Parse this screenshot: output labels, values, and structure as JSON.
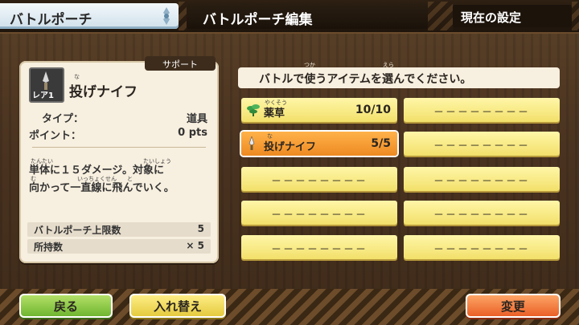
{
  "header": {
    "pouch_tab": "バトルポーチ",
    "screen_title": "バトルポーチ編集",
    "current_setting_button": "現在の設定"
  },
  "item_detail": {
    "category_tag": "サポート",
    "rarity": "レア1",
    "name": "投げナイフ",
    "name_furigana": "な",
    "type_label": "タイプ：",
    "type_value": "道具",
    "points_label": "ポイント：",
    "points_value": "0 pts",
    "description_line1": "単体に１５ダメージ。対象に",
    "description_line2": "向かって一直線に飛んでいく。",
    "furigana_tantai": "たんたい",
    "furigana_taishou": "たいしょう",
    "furigana_mu": "む",
    "furigana_icchokusen": "いっちょくせん",
    "furigana_to": "と",
    "pouch_limit_label": "バトルポーチ上限数",
    "pouch_limit_value": "5",
    "owned_label": "所持数",
    "owned_value": "× 5"
  },
  "prompt": {
    "text": "バトルで使うアイテムを選んでください。",
    "furigana_tsuka": "つか",
    "furigana_era": "えら"
  },
  "slots": [
    {
      "name": "薬草",
      "furigana": "やくそう",
      "count": "10/10",
      "selected": false,
      "icon": "herb-icon"
    },
    {
      "name": "投げナイフ",
      "furigana": "な",
      "count": "5/5",
      "selected": true,
      "icon": "knife-icon"
    },
    {
      "empty": "－－－－－－－－"
    },
    {
      "empty": "－－－－－－－－"
    },
    {
      "empty": "－－－－－－－－"
    },
    {
      "empty": "－－－－－－－－"
    },
    {
      "empty": "－－－－－－－－"
    },
    {
      "empty": "－－－－－－－－"
    },
    {
      "empty": "－－－－－－－－"
    },
    {
      "empty": "－－－－－－－－"
    }
  ],
  "footer": {
    "back_label": "戻る",
    "swap_label": "入れ替え",
    "change_label": "変更"
  },
  "colors": {
    "slot_yellow": "#f2e06a",
    "slot_selected": "#ee8a22",
    "back_green": "#6ab22e",
    "change_orange": "#e85a22"
  }
}
